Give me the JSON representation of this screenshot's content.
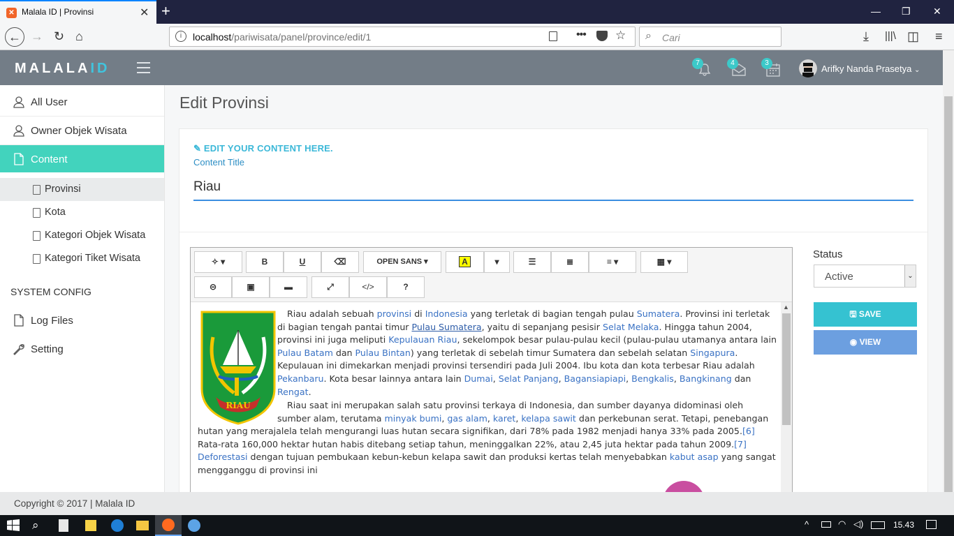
{
  "browser": {
    "tab_title": "Malala ID | Provinsi",
    "url_host": "localhost",
    "url_path": "/pariwisata/panel/province/edit/1",
    "search_placeholder": "Cari"
  },
  "header": {
    "logo_main": "MALALA",
    "logo_accent": "ID",
    "notif_count": "7",
    "mail_count": "4",
    "calendar_count": "3",
    "user_name": "Arifky Nanda Prasetya"
  },
  "sidebar": {
    "items": [
      {
        "label": "All User",
        "icon": "user-icon"
      },
      {
        "label": "Owner Objek Wisata",
        "icon": "user-icon"
      },
      {
        "label": "Content",
        "icon": "document-icon"
      }
    ],
    "sub_items": [
      {
        "label": "Provinsi"
      },
      {
        "label": "Kota"
      },
      {
        "label": "Kategori Objek Wisata"
      },
      {
        "label": "Kategori Tiket Wisata"
      }
    ],
    "section_label": "SYSTEM CONFIG",
    "config_items": [
      {
        "label": "Log Files",
        "icon": "document-icon"
      },
      {
        "label": "Setting",
        "icon": "wrench-icon"
      }
    ]
  },
  "main": {
    "page_title": "Edit Provinsi",
    "edit_label": "EDIT YOUR CONTENT HERE.",
    "content_title_label": "Content Title",
    "content_title_value": "Riau"
  },
  "editor": {
    "font_label": "OPEN SANS",
    "p1": [
      {
        "t": "Riau adalah sebuah "
      },
      {
        "t": "provinsi",
        "link": true
      },
      {
        "t": " di "
      },
      {
        "t": "Indonesia",
        "link": true
      },
      {
        "t": " yang terletak di bagian tengah pulau "
      },
      {
        "t": "Sumatera",
        "link": true
      },
      {
        "t": ". Provinsi ini terletak di bagian tengah pantai timur "
      },
      {
        "t": "Pulau Sumatera",
        "link": true,
        "u": true
      },
      {
        "t": ", yaitu di sepanjang pesisir "
      },
      {
        "t": "Selat Melaka",
        "link": true
      },
      {
        "t": ". Hingga tahun 2004, provinsi ini juga meliputi "
      },
      {
        "t": "Kepulauan Riau",
        "link": true
      },
      {
        "t": ", sekelompok besar pulau-pulau kecil (pulau-pulau utamanya antara lain "
      },
      {
        "t": "Pulau Batam",
        "link": true
      },
      {
        "t": " dan "
      },
      {
        "t": "Pulau Bintan",
        "link": true
      },
      {
        "t": ") yang terletak di sebelah timur Sumatera dan sebelah selatan "
      },
      {
        "t": "Singapura",
        "link": true
      },
      {
        "t": ". Kepulauan ini dimekarkan menjadi provinsi tersendiri pada Juli 2004. Ibu kota dan kota terbesar Riau adalah "
      },
      {
        "t": "Pekanbaru",
        "link": true
      },
      {
        "t": ". Kota besar lainnya antara lain "
      },
      {
        "t": "Dumai",
        "link": true
      },
      {
        "t": ", "
      },
      {
        "t": "Selat Panjang",
        "link": true
      },
      {
        "t": ", "
      },
      {
        "t": "Bagansiapiapi",
        "link": true
      },
      {
        "t": ", "
      },
      {
        "t": "Bengkalis",
        "link": true
      },
      {
        "t": ", "
      },
      {
        "t": "Bangkinang",
        "link": true
      },
      {
        "t": " dan "
      },
      {
        "t": "Rengat",
        "link": true
      },
      {
        "t": "."
      }
    ],
    "p2": [
      {
        "t": "Riau saat ini merupakan salah satu provinsi terkaya di Indonesia, dan sumber dayanya didominasi oleh sumber alam, terutama "
      },
      {
        "t": "minyak bumi",
        "link": true
      },
      {
        "t": ", "
      },
      {
        "t": "gas alam",
        "link": true
      },
      {
        "t": ", "
      },
      {
        "t": "karet",
        "link": true
      },
      {
        "t": ", "
      },
      {
        "t": "kelapa sawit",
        "link": true
      },
      {
        "t": " dan perkebunan serat. Tetapi, penebangan hutan yang merajalela telah mengurangi luas hutan secara signifikan, dari 78% pada 1982 menjadi hanya 33% pada 2005."
      },
      {
        "t": "[6]",
        "link": true
      },
      {
        "t": " Rata-rata 160,000 hektar hutan habis ditebang setiap tahun, meninggalkan 22%, atau 2,45 juta hektar pada tahun 2009."
      },
      {
        "t": "[7]",
        "link": true
      },
      {
        "t": " "
      },
      {
        "t": "Deforestasi",
        "link": true
      },
      {
        "t": " dengan tujuan pembukaan kebun-kebun kelapa sawit dan produksi kertas telah menyebabkan "
      },
      {
        "t": "kabut asap",
        "link": true
      },
      {
        "t": " yang sangat mengganggu di provinsi ini"
      }
    ],
    "crest_text": "RIAU"
  },
  "status": {
    "label": "Status",
    "value": "Active",
    "save_label": "SAVE",
    "view_label": "VIEW"
  },
  "footer": {
    "copyright": "Copyright © 2017 | Malala ID"
  },
  "taskbar": {
    "time": "15.43"
  },
  "colors": {
    "accent": "#42d3bd",
    "header": "#737d87",
    "save": "#35c2d1",
    "view": "#6c9fe0"
  }
}
